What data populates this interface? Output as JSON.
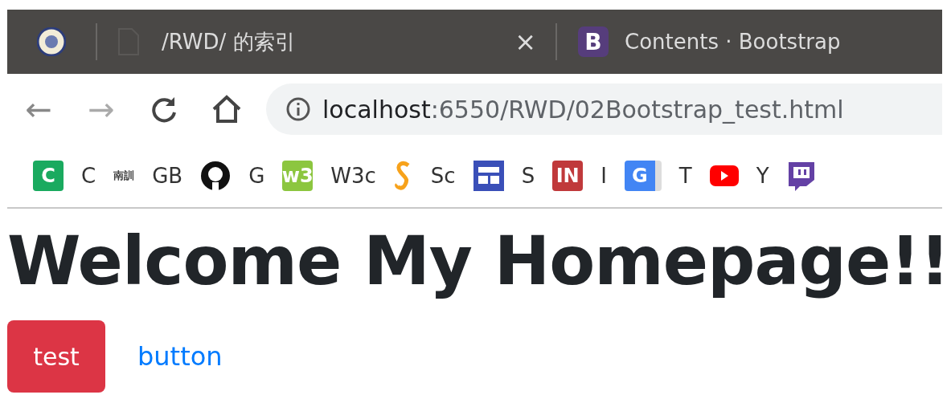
{
  "tabs": [
    {
      "kind": "pinned"
    },
    {
      "kind": "page",
      "title": "/RWD/ 的索引",
      "close": "×"
    },
    {
      "kind": "bootstrap",
      "title": "Contents · Bootstrap",
      "badge": "B"
    }
  ],
  "toolbar": {
    "back": "←",
    "forward": "→",
    "url_host": "localhost",
    "url_rest": ":6550/RWD/02Bootstrap_test.html"
  },
  "bookmarks": [
    {
      "kind": "letter",
      "badge": "C",
      "color": "#1aaa5f",
      "label": "C"
    },
    {
      "kind": "word",
      "badge": "南訓",
      "label": "GB"
    },
    {
      "kind": "github",
      "label": "G"
    },
    {
      "kind": "letter",
      "badge": "w3",
      "color": "#8cc63f",
      "label": "W3c"
    },
    {
      "kind": "scratch",
      "label": "Sc"
    },
    {
      "kind": "layout",
      "label": "S"
    },
    {
      "kind": "letter",
      "badge": "IN",
      "color": "#c0393b",
      "label": "I"
    },
    {
      "kind": "translate",
      "badge": "G",
      "label": "T"
    },
    {
      "kind": "youtube",
      "label": "Y"
    },
    {
      "kind": "twitch"
    }
  ],
  "page": {
    "heading": "Welcome My Homepage!!",
    "buttons": [
      {
        "kind": "danger",
        "label": "test"
      },
      {
        "kind": "link",
        "label": "button"
      }
    ]
  }
}
